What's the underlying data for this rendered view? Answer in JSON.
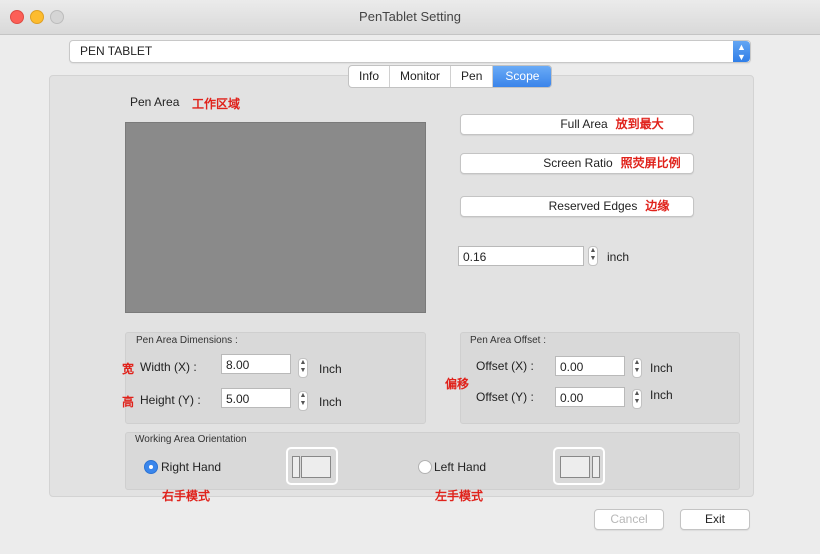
{
  "window": {
    "title": "PenTablet Setting"
  },
  "device": {
    "selected": "PEN TABLET"
  },
  "tabs": [
    {
      "label": "Info"
    },
    {
      "label": "Monitor"
    },
    {
      "label": "Pen"
    },
    {
      "label": "Scope",
      "active": true
    }
  ],
  "pen_area": {
    "label": "Pen Area",
    "annotation": "工作区域"
  },
  "buttons": {
    "full_area": {
      "label": "Full Area",
      "annotation": "放到最大"
    },
    "screen_ratio": {
      "label": "Screen Ratio",
      "annotation": "照荧屏比例"
    },
    "reserved_edges": {
      "label": "Reserved Edges",
      "annotation": "边缘"
    },
    "cancel": "Cancel",
    "exit": "Exit"
  },
  "edge_field": {
    "value": "0.16",
    "unit": "inch"
  },
  "dimensions": {
    "title": "Pen Area Dimensions :",
    "width_label": "Width  (X) :",
    "width_value": "8.00",
    "width_unit": "Inch",
    "width_annotation": "宽",
    "height_label": "Height (Y) :",
    "height_value": "5.00",
    "height_unit": "Inch",
    "height_annotation": "高"
  },
  "offset": {
    "title": "Pen Area Offset :",
    "annotation": "偏移",
    "x_label": "Offset (X) :",
    "x_value": "0.00",
    "x_unit": "Inch",
    "y_label": "Offset (Y) :",
    "y_value": "0.00",
    "y_unit": "Inch"
  },
  "orientation": {
    "title": "Working Area Orientation",
    "right_label": "Right Hand",
    "right_annotation": "右手模式",
    "left_label": "Left Hand",
    "left_annotation": "左手模式",
    "selected": "right"
  },
  "colors": {
    "accent": "#3a84ea",
    "annotation": "#e0221b",
    "preview": "#8a8a8a"
  }
}
